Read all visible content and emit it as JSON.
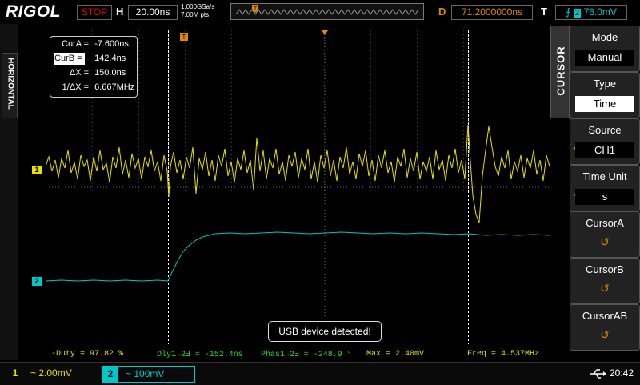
{
  "top": {
    "brand": "RIGOL",
    "run_status": "STOP",
    "h_label": "H",
    "timebase": "20.00ns",
    "sample_rate": "1.000GSa/s",
    "memory_depth": "7.00M pts",
    "d_label": "D",
    "delay": "71.2000000ns",
    "t_label": "T",
    "trigger_channel": "2",
    "trigger_level": "76.0mV"
  },
  "left": {
    "horizontal_label": "HORIZONTAL"
  },
  "cursor_readout": {
    "cur_a_label": "CurA =",
    "cur_a_value": "-7.600ns",
    "cur_b_label": "CurB =",
    "cur_b_value": "142.4ns",
    "delta_label": "ΔX =",
    "delta_value": "150.0ns",
    "inv_delta_label": "1/ΔX =",
    "inv_delta_value": "6.667MHz"
  },
  "channel_markers": {
    "ch1": "1",
    "ch2": "2"
  },
  "menu": {
    "title": "CURSOR",
    "items": [
      {
        "title": "Mode",
        "value": "Manual"
      },
      {
        "title": "Type",
        "value": "Time"
      },
      {
        "title": "Source",
        "value": "CH1"
      },
      {
        "title": "Time Unit",
        "value": "s"
      },
      {
        "title": "CursorA",
        "value": ""
      },
      {
        "title": "CursorB",
        "value": ""
      },
      {
        "title": "CursorAB",
        "value": ""
      }
    ]
  },
  "measurements": {
    "duty": "-Duty = 97.82 %",
    "dly": "Dly1→2Ⅎ = -152.4ns",
    "phase": "Phas1→2Ⅎ = -248.9 °",
    "max": "Max = 2.40mV",
    "freq": "Freq = 4.537MHz"
  },
  "toast": "USB device detected!",
  "bottom": {
    "ch1_num": "1",
    "ch1_scale": "~  2.00mV",
    "ch2_num": "2",
    "ch2_scale": "~  100mV",
    "time": "20:42"
  },
  "colors": {
    "ch1": "#e8e000",
    "ch2": "#00c8c8",
    "accent": "#e08a00",
    "stop": "#ee0000"
  }
}
